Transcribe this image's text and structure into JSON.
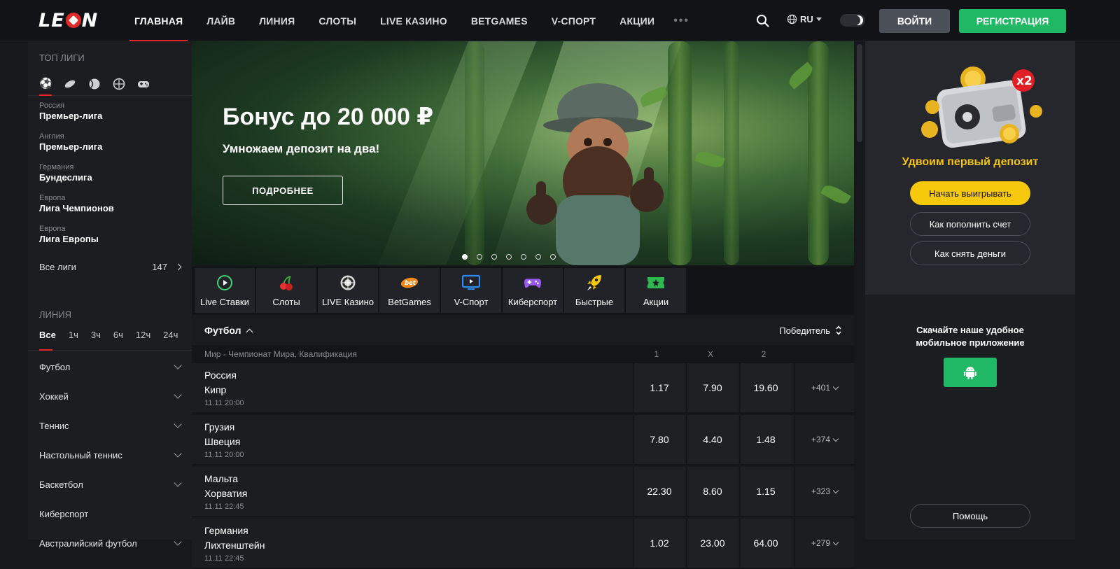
{
  "header": {
    "logo": "LEON",
    "nav": [
      "ГЛАВНАЯ",
      "ЛАЙВ",
      "ЛИНИЯ",
      "СЛОТЫ",
      "LIVE КАЗИНО",
      "BETGAMES",
      "V-СПОРТ",
      "АКЦИИ"
    ],
    "more": "•••",
    "lang": "RU",
    "login": "ВОЙТИ",
    "register": "РЕГИСТРАЦИЯ",
    "accent": "#e5252a",
    "green": "#20b864"
  },
  "sidebar": {
    "top_leagues_title": "ТОП ЛИГИ",
    "sport_icons": [
      "soccer-ball-icon",
      "hockey-puck-icon",
      "tennis-ball-icon",
      "basketball-icon",
      "gamepad-icon"
    ],
    "leagues": [
      {
        "country": "Россия",
        "name": "Премьер-лига"
      },
      {
        "country": "Англия",
        "name": "Премьер-лига"
      },
      {
        "country": "Германия",
        "name": "Бундеслига"
      },
      {
        "country": "Европа",
        "name": "Лига Чемпионов"
      },
      {
        "country": "Европа",
        "name": "Лига Европы"
      }
    ],
    "all_leagues": "Все лиги",
    "all_leagues_count": "147",
    "line_title": "ЛИНИЯ",
    "periods": [
      "Все",
      "1ч",
      "3ч",
      "6ч",
      "12ч",
      "24ч"
    ],
    "sports": [
      "Футбол",
      "Хоккей",
      "Теннис",
      "Настольный теннис",
      "Баскетбол",
      "Киберспорт",
      "Австралийский футбол"
    ]
  },
  "banner": {
    "title": "Бонус до 20 000 ₽",
    "subtitle": "Умножаем депозит на два!",
    "button": "ПОДРОБНЕЕ",
    "slides": 7,
    "active_slide": 1
  },
  "tiles": [
    {
      "label": "Live Ставки",
      "icon": "live-play-icon"
    },
    {
      "label": "Слоты",
      "icon": "cherries-icon"
    },
    {
      "label": "LIVE Казино",
      "icon": "roulette-icon"
    },
    {
      "label": "BetGames",
      "icon": "betgames-logo-icon"
    },
    {
      "label": "V-Спорт",
      "icon": "monitor-icon"
    },
    {
      "label": "Киберспорт",
      "icon": "gamepad-icon"
    },
    {
      "label": "Быстрые",
      "icon": "rocket-icon"
    },
    {
      "label": "Акции",
      "icon": "ticket-icon"
    }
  ],
  "events": {
    "sport": "Футбол",
    "sort": "Победитель",
    "league": "Мир - Чемпионат Мира, Квалификация",
    "columns": [
      "1",
      "X",
      "2"
    ],
    "matches": [
      {
        "home": "Россия",
        "away": "Кипр",
        "time": "11.11 20:00",
        "o1": "1.17",
        "ox": "7.90",
        "o2": "19.60",
        "more": "+401"
      },
      {
        "home": "Грузия",
        "away": "Швеция",
        "time": "11.11 20:00",
        "o1": "7.80",
        "ox": "4.40",
        "o2": "1.48",
        "more": "+374"
      },
      {
        "home": "Мальта",
        "away": "Хорватия",
        "time": "11.11 22:45",
        "o1": "22.30",
        "ox": "8.60",
        "o2": "1.15",
        "more": "+323"
      },
      {
        "home": "Германия",
        "away": "Лихтенштейн",
        "time": "11.11 22:45",
        "o1": "1.02",
        "ox": "23.00",
        "o2": "64.00",
        "more": "+279"
      }
    ]
  },
  "right_panel": {
    "multiplier": "x2",
    "title": "Удвоим первый депозит",
    "start_button": "Начать выигрывать",
    "deposit_button": "Как пополнить счет",
    "withdraw_button": "Как снять деньги",
    "app_text_1": "Скачайте наше удобное",
    "app_text_2": "мобильное приложение",
    "help_button": "Помощь",
    "gold": "#f7c90d"
  }
}
